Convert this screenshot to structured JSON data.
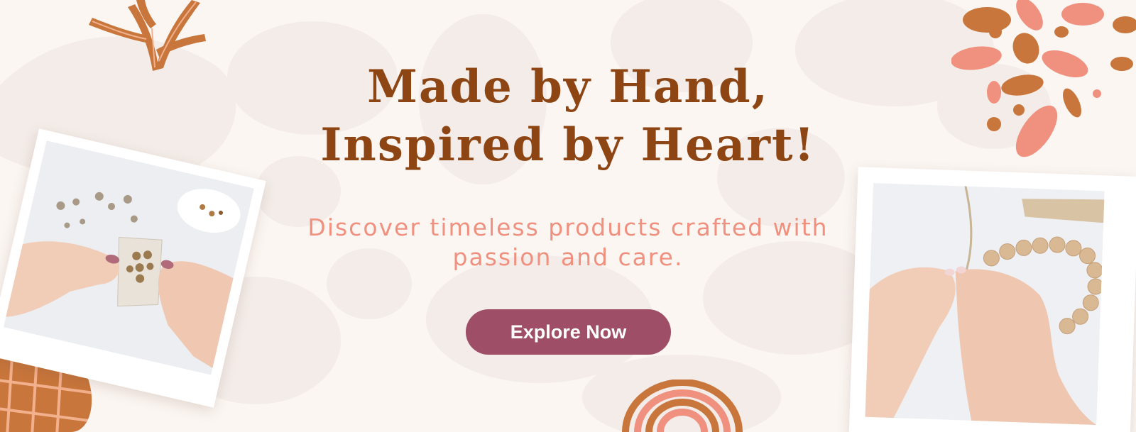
{
  "hero": {
    "headline_line1": "Made by Hand,",
    "headline_line2": "Inspired by Heart!",
    "subtitle_line1": "Discover timeless products crafted with",
    "subtitle_line2": "passion and care.",
    "cta_label": "Explore Now"
  },
  "colors": {
    "background": "#fbf6f2",
    "headline": "#8e4514",
    "subtitle": "#f0907f",
    "cta_background": "#9e4e66",
    "cta_text": "#ffffff",
    "accent_brown": "#c8763b",
    "accent_coral": "#f0907f"
  },
  "icons": {
    "leaf": "leaf-icon",
    "dots": "dots-cluster-icon",
    "grid": "grid-blob-icon",
    "rainbow": "rainbow-arch-icon"
  },
  "images": {
    "left_photo": "hands-sorting-beads-photo",
    "right_photo": "hands-threading-wooden-bead-bracelet-photo"
  }
}
